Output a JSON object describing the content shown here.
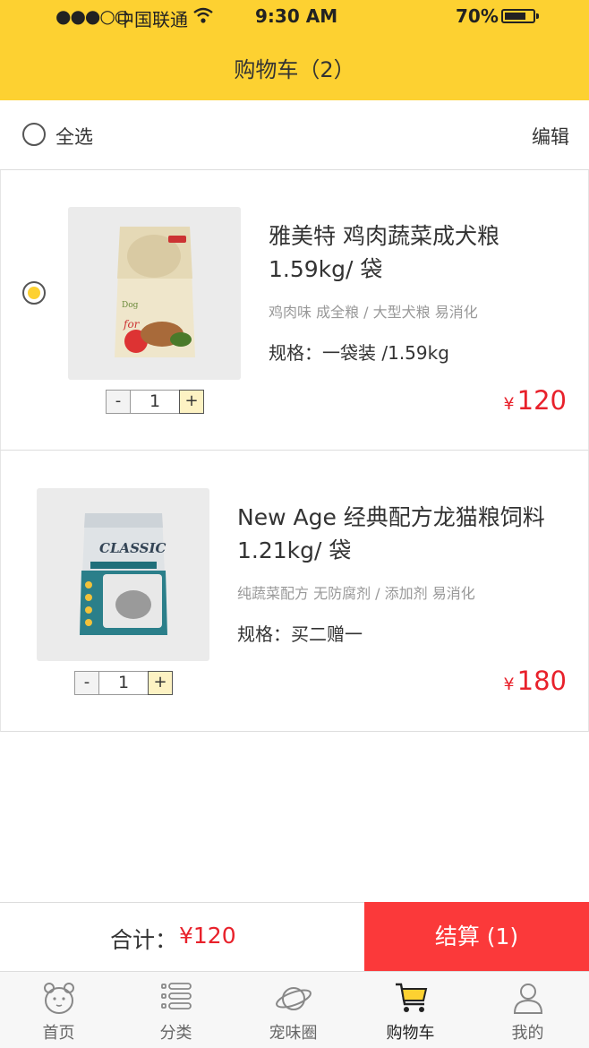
{
  "status_bar": {
    "signal": "●●●○○",
    "carrier": "中国联通",
    "time": "9:30 AM",
    "battery": "70%",
    "battery_level": 0.7
  },
  "header": {
    "title": "购物车（2）"
  },
  "select_bar": {
    "select_all_label": "全选",
    "edit_label": "编辑"
  },
  "items": [
    {
      "name": "雅美特 鸡肉蔬菜成犬粮 1.59kg/ 袋",
      "tags": "鸡肉味 成全粮 / 大型犬粮 易消化",
      "spec": "规格：一袋装 /1.59kg",
      "currency": "¥",
      "price": "120",
      "quantity": "1",
      "minus": "-",
      "plus": "+",
      "selected": true
    },
    {
      "name": "New Age 经典配方龙猫粮饲料 1.21kg/ 袋",
      "tags": "纯蔬菜配方 无防腐剂 / 添加剂 易消化",
      "spec": "规格：买二赠一",
      "currency": "¥",
      "price": "180",
      "quantity": "1",
      "minus": "-",
      "plus": "+",
      "selected": false
    }
  ],
  "footer": {
    "total_label": "合计：",
    "total_amount": "¥120",
    "checkout_label": "结算 (1)"
  },
  "tabs": [
    {
      "label": "首页",
      "icon": "hamster-icon"
    },
    {
      "label": "分类",
      "icon": "list-icon"
    },
    {
      "label": "宠味圈",
      "icon": "planet-icon"
    },
    {
      "label": "购物车",
      "icon": "cart-icon",
      "active": true
    },
    {
      "label": "我的",
      "icon": "user-icon"
    }
  ],
  "colors": {
    "brand_yellow": "#fdd131",
    "price_red": "#e8212b",
    "checkout_red": "#fb393a"
  }
}
